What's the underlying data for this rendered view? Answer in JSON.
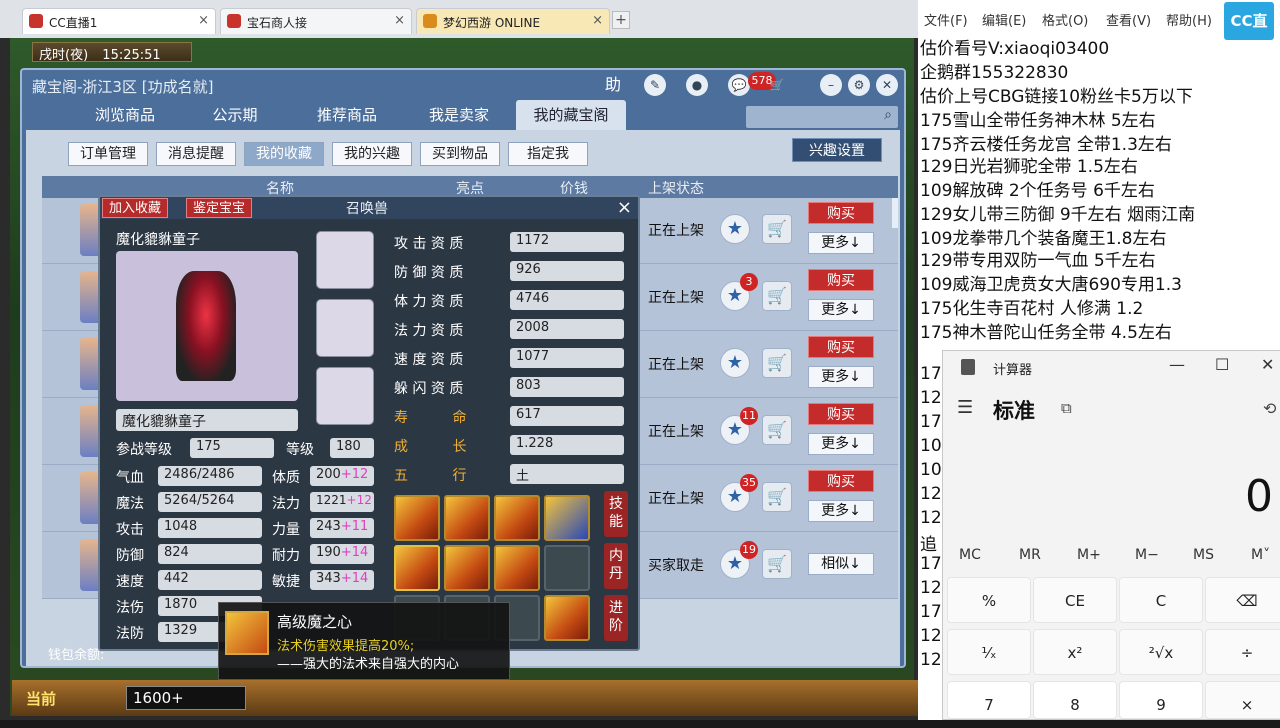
{
  "browser_tabs": [
    {
      "label": "CC直播1"
    },
    {
      "label": "宝石商人接"
    },
    {
      "label": "梦幻西游 ONLINE"
    }
  ],
  "game": {
    "time_label": "戌时(夜)",
    "clock": "15:25:51",
    "window_title": "藏宝阁-浙江3区 [功成名就]",
    "icon_help": "助",
    "badge_578": "578",
    "nav": [
      "浏览商品",
      "公示期",
      "推荐商品",
      "我是卖家",
      "我的藏宝阁"
    ],
    "subnav": [
      "订单管理",
      "消息提醒",
      "我的收藏",
      "我的兴趣",
      "买到物品",
      "指定我"
    ],
    "interest_btn": "兴趣设置",
    "table_headers": [
      "名称",
      "亮点",
      "价钱",
      "上架状态"
    ],
    "rows": [
      {
        "status": "正在上架",
        "badge": "",
        "action1": "购买",
        "action2": "更多↓"
      },
      {
        "status": "正在上架",
        "badge": "3",
        "action1": "购买",
        "action2": "更多↓"
      },
      {
        "status": "正在上架",
        "badge": "",
        "action1": "购买",
        "action2": "更多↓"
      },
      {
        "status": "正在上架",
        "badge": "11",
        "action1": "购买",
        "action2": "更多↓"
      },
      {
        "status": "正在上架",
        "badge": "35",
        "action1": "购买",
        "action2": "更多↓"
      },
      {
        "status": "买家取走",
        "badge": "19",
        "action1": "",
        "action2": "相似↓"
      }
    ],
    "wallet": "钱包余额:",
    "panel": {
      "title": "召唤兽",
      "btn_add": "加入收藏",
      "btn_appraise": "鉴定宝宝",
      "close": "×",
      "pet_name": "魔化貔貅童子",
      "pet_name_box": "魔化貔貅童子",
      "aptitudes": [
        {
          "label": "攻 击 资 质",
          "value": "1172"
        },
        {
          "label": "防 御 资 质",
          "value": "926"
        },
        {
          "label": "体 力 资 质",
          "value": "4746"
        },
        {
          "label": "法 力 资 质",
          "value": "2008"
        },
        {
          "label": "速 度 资 质",
          "value": "1077"
        },
        {
          "label": "躲 闪 资 质",
          "value": "803"
        },
        {
          "label": "寿 命",
          "value": "617"
        },
        {
          "label": "成 长",
          "value": "1.228"
        },
        {
          "label": "五 行",
          "value": "土"
        }
      ],
      "level_label": "参战等级",
      "level_value": "175",
      "grade_label": "等级",
      "grade_value": "180",
      "stats_left": [
        {
          "label": "气血",
          "value": "2486/2486"
        },
        {
          "label": "魔法",
          "value": "5264/5264"
        },
        {
          "label": "攻击",
          "value": "1048"
        },
        {
          "label": "防御",
          "value": "824"
        },
        {
          "label": "速度",
          "value": "442"
        },
        {
          "label": "法伤",
          "value": "1870"
        },
        {
          "label": "法防",
          "value": "1329"
        }
      ],
      "stats_right": [
        {
          "label": "体质",
          "value": "200",
          "plus": "+12"
        },
        {
          "label": "法力",
          "value": "1221",
          "plus": "+12"
        },
        {
          "label": "力量",
          "value": "243",
          "plus": "+11"
        },
        {
          "label": "耐力",
          "value": "190",
          "plus": "+14"
        },
        {
          "label": "敏捷",
          "value": "343",
          "plus": "+14"
        }
      ],
      "side_tabs": [
        "技能",
        "内丹",
        "进阶"
      ]
    },
    "tooltip": {
      "name": "高级魔之心",
      "effect": "法术伤害效果提高20%;",
      "desc": "——强大的法术来自强大的内心"
    },
    "bottom": {
      "current": "当前",
      "input": "1600+"
    }
  },
  "notepad": {
    "menu": [
      "文件(F)",
      "编辑(E)",
      "格式(O)",
      "查看(V)",
      "帮助(H)"
    ],
    "logo": "CC直播",
    "lines": [
      "估价看号V:xiaoqi03400",
      "企鹅群155322830",
      "估价上号CBG链接10粉丝卡5万以下",
      "175雪山全带任务神木林 5左右",
      "175齐云楼任务龙宫 全带1.3左右",
      "129日光岩狮驼全带 1.5左右",
      "109解放碑 2个任务号 6千左右",
      "129女儿带三防御 9千左右 烟雨江南",
      "109龙拳带几个装备魔王1.8左右",
      "129带专用双防一气血 5千左右",
      "109威海卫虎贲女大唐690专用1.3",
      "175化生寺百花村 人修满 1.2",
      "175神木普陀山任务全带 4.5左右"
    ],
    "truncated_prefixes": [
      "17",
      "12",
      "17",
      "10",
      "10",
      "12",
      "12",
      "追",
      "17",
      "12",
      "17",
      "12",
      "12"
    ]
  },
  "calculator": {
    "title": "计算器",
    "mode": "标准",
    "display": "0",
    "memory": [
      "MC",
      "MR",
      "M+",
      "M−",
      "MS",
      "M˅"
    ],
    "keys_row1": [
      "%",
      "CE",
      "C",
      "⌫"
    ],
    "keys_row2": [
      "¹⁄ₓ",
      "x²",
      "²√x",
      "÷"
    ],
    "keys_row3": [
      "7",
      "8",
      "9",
      "×"
    ]
  }
}
